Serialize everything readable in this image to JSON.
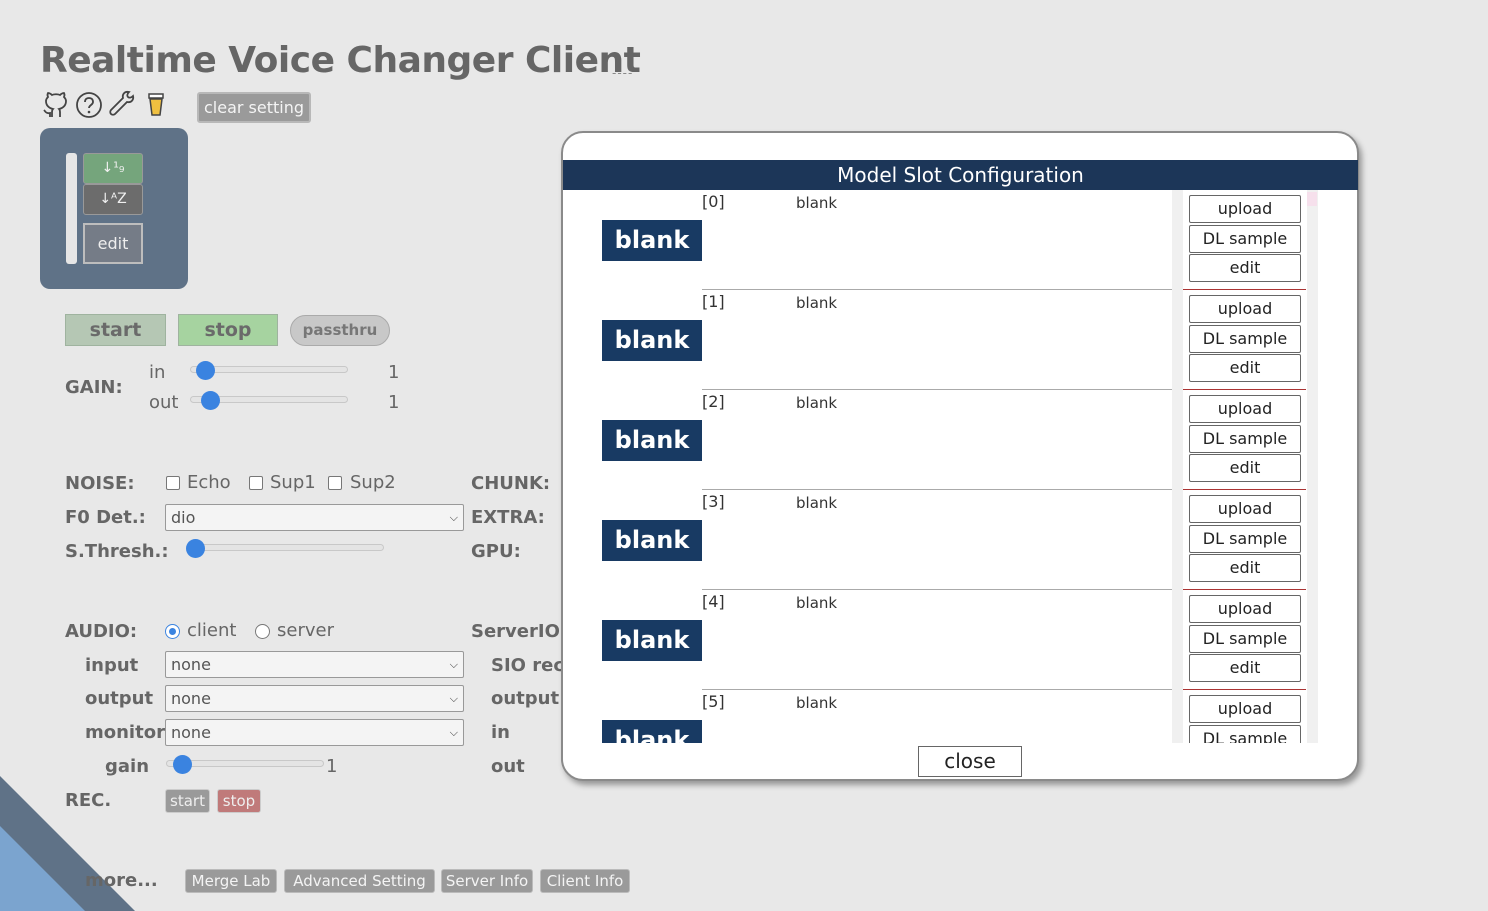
{
  "header": {
    "title": "Realtime Voice Changer Client",
    "title_suffix": "----",
    "clear_setting": "clear setting",
    "icons": [
      "github-icon",
      "help-icon",
      "wrench-icon",
      "coffee-icon"
    ]
  },
  "slot_panel": {
    "sort_asc": "↓¹₉",
    "sort_desc": "↓ᴬZ",
    "edit": "edit"
  },
  "controls": {
    "start": "start",
    "stop": "stop",
    "passthru": "passthru",
    "gain_label": "GAIN:",
    "gain_in_label": "in",
    "gain_in_value": "1",
    "gain_out_label": "out",
    "gain_out_value": "1",
    "noise_label": "NOISE:",
    "noise_echo": "Echo",
    "noise_sup1": "Sup1",
    "noise_sup2": "Sup2",
    "f0_label": "F0 Det.:",
    "f0_value": "dio",
    "sthresh_label": "S.Thresh.:",
    "chunk_label": "CHUNK:",
    "extra_label": "EXTRA:",
    "gpu_label": "GPU:",
    "audio_label": "AUDIO:",
    "audio_client": "client",
    "audio_server": "server",
    "input_label": "input",
    "input_value": "none",
    "output_label": "output",
    "output_value": "none",
    "monitor_label": "monitor",
    "monitor_value": "none",
    "gain_label2": "gain",
    "gain_value2": "1",
    "serverio_label": "ServerIO",
    "sio_rec_label": "SIO rec",
    "sio_output_label": "output",
    "sio_in_label": "in",
    "sio_out_label": "out",
    "rec_label": "REC.",
    "rec_start": "start",
    "rec_stop": "stop",
    "more_label": "more...",
    "more_buttons": [
      "Merge Lab",
      "Advanced Setting",
      "Server Info",
      "Client Info"
    ]
  },
  "modal": {
    "title": "Model Slot Configuration",
    "close": "close",
    "btn_upload": "upload",
    "btn_dl_sample": "DL sample",
    "btn_edit": "edit",
    "slots": [
      {
        "index": "[0]",
        "name": "blank",
        "thumb": "blank"
      },
      {
        "index": "[1]",
        "name": "blank",
        "thumb": "blank"
      },
      {
        "index": "[2]",
        "name": "blank",
        "thumb": "blank"
      },
      {
        "index": "[3]",
        "name": "blank",
        "thumb": "blank"
      },
      {
        "index": "[4]",
        "name": "blank",
        "thumb": "blank"
      },
      {
        "index": "[5]",
        "name": "blank",
        "thumb": "blank"
      }
    ]
  },
  "colors": {
    "modal_header": "#1c3658",
    "slot_thumb": "#183a63",
    "slot_panel": "#5f7287",
    "slider_accent": "#3a83e0",
    "stop_active": "#a6d3a0"
  }
}
